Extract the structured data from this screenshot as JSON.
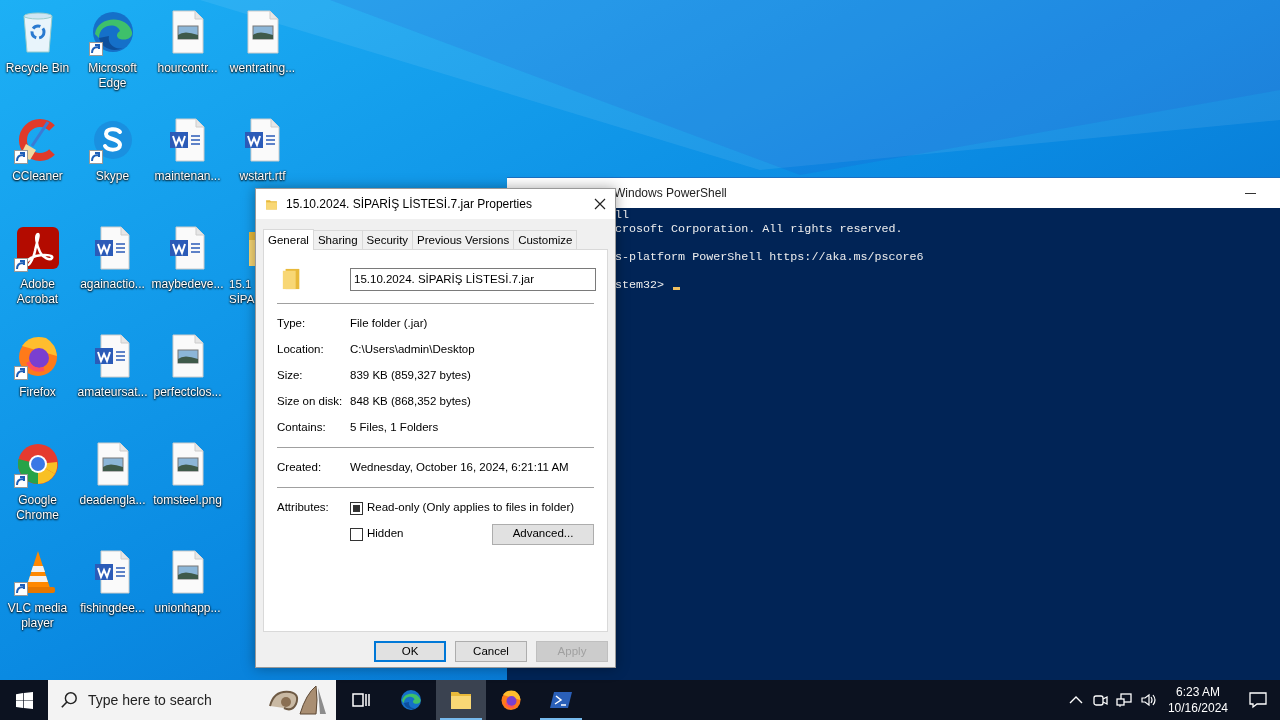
{
  "desktop_icon_rows": [
    [
      {
        "label": "Recycle Bin",
        "kind": "recycle",
        "shortcut": false
      },
      {
        "label": "Microsoft Edge",
        "kind": "edge",
        "shortcut": true
      },
      {
        "label": "hourcontr...",
        "kind": "image",
        "shortcut": false
      },
      {
        "label": "wentrating...",
        "kind": "image",
        "shortcut": false
      }
    ],
    [
      {
        "label": "CCleaner",
        "kind": "ccleaner",
        "shortcut": true
      },
      {
        "label": "Skype",
        "kind": "skype",
        "shortcut": true
      },
      {
        "label": "maintenan...",
        "kind": "word",
        "shortcut": false
      },
      {
        "label": "wstart.rtf",
        "kind": "word",
        "shortcut": false
      }
    ],
    [
      {
        "label": "Adobe Acrobat",
        "kind": "acrobat",
        "shortcut": true
      },
      {
        "label": "againactio...",
        "kind": "word",
        "shortcut": false
      },
      {
        "label": "maybedeve...",
        "kind": "word",
        "shortcut": false
      },
      {
        "label": "15.1 SİPA",
        "kind": "folder",
        "shortcut": false,
        "clipped": true
      }
    ],
    [
      {
        "label": "Firefox",
        "kind": "firefox",
        "shortcut": true
      },
      {
        "label": "amateursat...",
        "kind": "word",
        "shortcut": false
      },
      {
        "label": "perfectclos...",
        "kind": "image",
        "shortcut": false
      }
    ],
    [
      {
        "label": "Google Chrome",
        "kind": "chrome",
        "shortcut": true
      },
      {
        "label": "deadengla...",
        "kind": "image",
        "shortcut": false
      },
      {
        "label": "tomsteel.png",
        "kind": "image",
        "shortcut": false
      }
    ],
    [
      {
        "label": "VLC media player",
        "kind": "vlc",
        "shortcut": true
      },
      {
        "label": "fishingdee...",
        "kind": "word",
        "shortcut": false
      },
      {
        "label": "unionhapp...",
        "kind": "image",
        "shortcut": false
      }
    ]
  ],
  "powershell": {
    "title": "Windows PowerShell",
    "paragraphs": [
      [
        "ll",
        "crosoft Corporation. All rights reserved."
      ],
      [
        "s-platform PowerShell https://aka.ms/pscore6"
      ],
      [
        "stem32>"
      ]
    ],
    "cursor": true
  },
  "properties_dialog": {
    "title": "15.10.2024. SİPARİŞ LİSTESİ.7.jar Properties",
    "tabs": [
      {
        "label": "General",
        "selected": true
      },
      {
        "label": "Sharing",
        "selected": false
      },
      {
        "label": "Security",
        "selected": false
      },
      {
        "label": "Previous Versions",
        "selected": false
      },
      {
        "label": "Customize",
        "selected": false
      }
    ],
    "name_value": "15.10.2024. SİPARİŞ LİSTESİ.7.jar",
    "details": [
      {
        "label": "Type:",
        "value": "File folder (.jar)"
      },
      {
        "label": "Location:",
        "value": "C:\\Users\\admin\\Desktop"
      },
      {
        "label": "Size:",
        "value": "839 KB (859,327 bytes)"
      },
      {
        "label": "Size on disk:",
        "value": "848 KB (868,352 bytes)"
      },
      {
        "label": "Contains:",
        "value": "5 Files, 1 Folders"
      }
    ],
    "created": {
      "label": "Created:",
      "value": "Wednesday, October 16, 2024, 6:21:11 AM"
    },
    "attributes_label": "Attributes:",
    "attributes": [
      {
        "label": "Read-only (Only applies to files in folder)",
        "indeterminate": true
      },
      {
        "label": "Hidden",
        "checked": false
      }
    ],
    "advanced_button": "Advanced...",
    "buttons": [
      {
        "label": "OK",
        "default": true,
        "disabled": false
      },
      {
        "label": "Cancel",
        "default": false,
        "disabled": false
      },
      {
        "label": "Apply",
        "default": false,
        "disabled": true
      }
    ]
  },
  "taskbar": {
    "search_placeholder": "Type here to search",
    "apps": [
      {
        "kind": "taskview",
        "running": false,
        "focused": false
      },
      {
        "kind": "edge",
        "running": false,
        "focused": false
      },
      {
        "kind": "explorer",
        "running": true,
        "focused": true
      },
      {
        "kind": "firefox",
        "running": false,
        "focused": false
      },
      {
        "kind": "powershell",
        "running": true,
        "focused": false
      }
    ],
    "clock_time": "6:23 AM",
    "clock_date": "10/16/2024"
  }
}
